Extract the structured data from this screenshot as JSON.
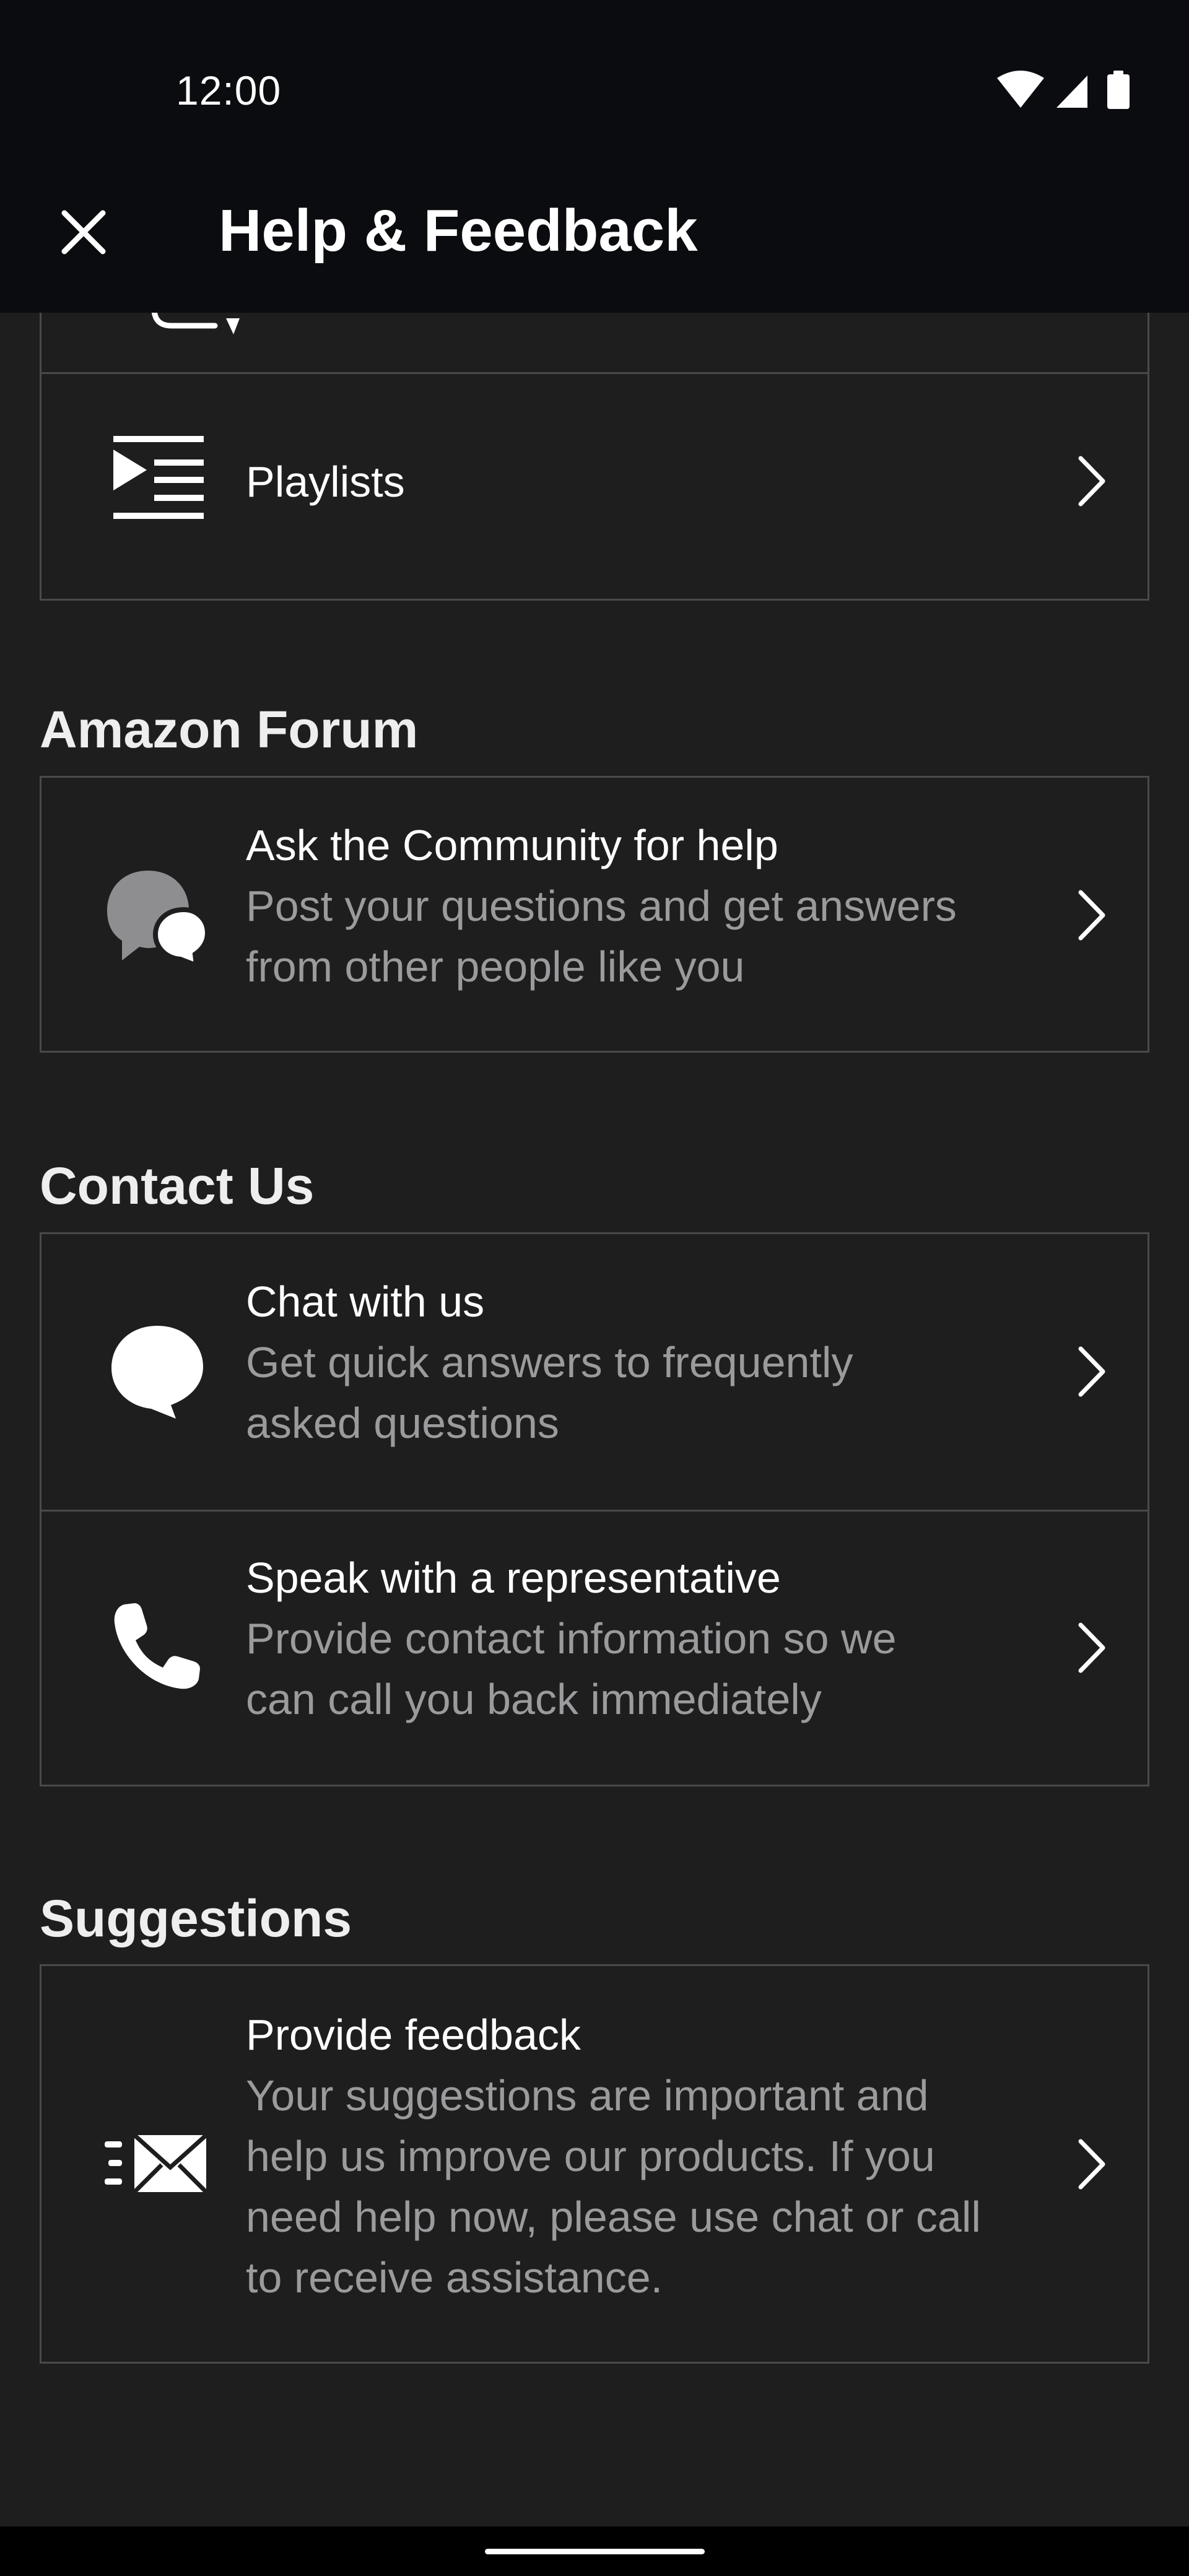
{
  "status_bar": {
    "time": "12:00"
  },
  "app_bar": {
    "title": "Help & Feedback"
  },
  "top_card": {
    "playlists_label": "Playlists"
  },
  "sections": {
    "forum": {
      "title": "Amazon Forum",
      "items": [
        {
          "title": "Ask the Community for help",
          "desc_line1": "Post your questions and get answers",
          "desc_line2": "from other people like you",
          "icon": "community-chat-icon"
        }
      ]
    },
    "contact": {
      "title": "Contact Us",
      "items": [
        {
          "title": "Chat with us",
          "desc_line1": "Get quick answers to frequently",
          "desc_line2": "asked questions",
          "icon": "chat-bubble-icon"
        },
        {
          "title": "Speak with a representative",
          "desc_line1": "Provide contact information so we",
          "desc_line2": "can call you back immediately",
          "icon": "phone-icon"
        }
      ]
    },
    "suggestions": {
      "title": "Suggestions",
      "items": [
        {
          "title": "Provide feedback",
          "desc_line1": "Your suggestions are important and",
          "desc_line2": "help us improve our products. If you",
          "desc_line3": "need help now, please use chat or call",
          "desc_line4": "to receive assistance.",
          "icon": "send-mail-icon"
        }
      ]
    }
  },
  "colors": {
    "background": "#1e1e1f",
    "header": "#0b0c0f",
    "border": "#4a4a4c",
    "secondary_text": "#9b9b9d"
  }
}
